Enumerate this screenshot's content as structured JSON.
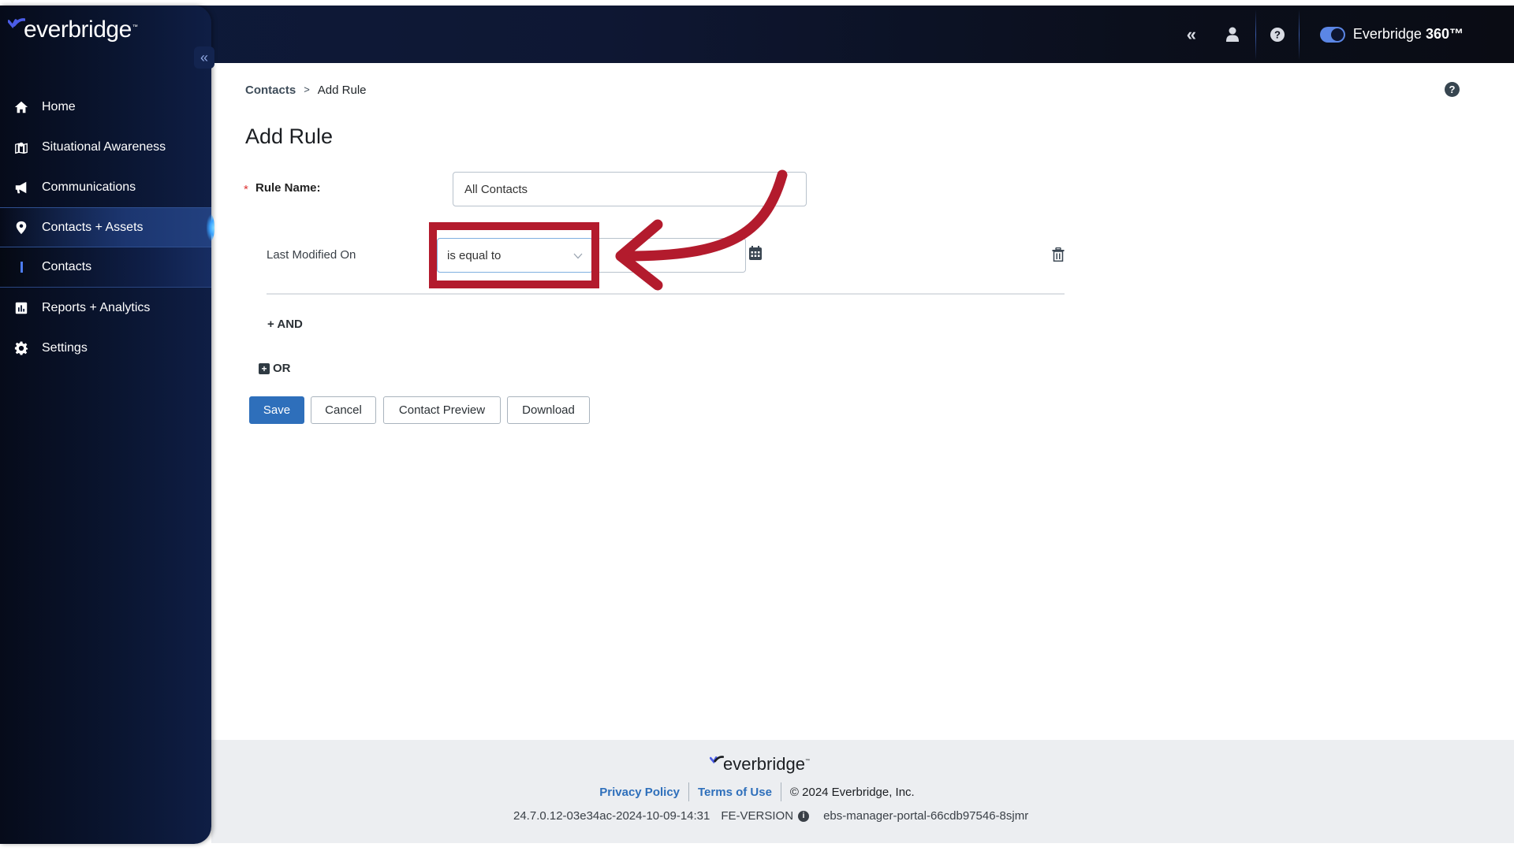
{
  "app": {
    "brand": "everbridge",
    "product_label": "Everbridge",
    "product_suffix": "360™",
    "collapse_glyph": "«"
  },
  "header": {
    "icons": [
      "collapse-double-chevron-icon",
      "user-icon",
      "help-icon"
    ],
    "toggle_on": true
  },
  "sidebar": {
    "items": [
      {
        "label": "Home",
        "icon": "home-icon"
      },
      {
        "label": "Situational Awareness",
        "icon": "map-pin-icon"
      },
      {
        "label": "Communications",
        "icon": "megaphone-icon"
      },
      {
        "label": "Contacts + Assets",
        "icon": "location-pin-icon",
        "active": true
      },
      {
        "label": "Contacts",
        "sub": true,
        "selected": true
      },
      {
        "label": "Reports + Analytics",
        "icon": "bar-chart-icon"
      },
      {
        "label": "Settings",
        "icon": "gear-icon"
      }
    ]
  },
  "breadcrumb": {
    "parent": "Contacts",
    "separator": ">",
    "current": "Add Rule"
  },
  "page": {
    "title": "Add Rule",
    "rule_name_label": "Rule Name:",
    "required_mark": "*",
    "rule_name_value": "All Contacts"
  },
  "condition": {
    "field_label": "Last Modified On",
    "operator": "is equal to",
    "date_value": ""
  },
  "actions": {
    "and_label": "+ AND",
    "or_label": "OR",
    "save": "Save",
    "cancel": "Cancel",
    "contact_preview": "Contact Preview",
    "download": "Download"
  },
  "footer": {
    "logo": "everbridge",
    "privacy_policy": "Privacy Policy",
    "terms_of_use": "Terms of Use",
    "copyright": "© 2024 Everbridge, Inc.",
    "build": "24.7.0.12-03e34ac-2024-10-09-14:31",
    "fe_version": "FE-VERSION",
    "pod": "ebs-manager-portal-66cdb97546-8sjmr"
  },
  "annotation": {
    "color": "#b31b2d",
    "target": "operator-select"
  }
}
